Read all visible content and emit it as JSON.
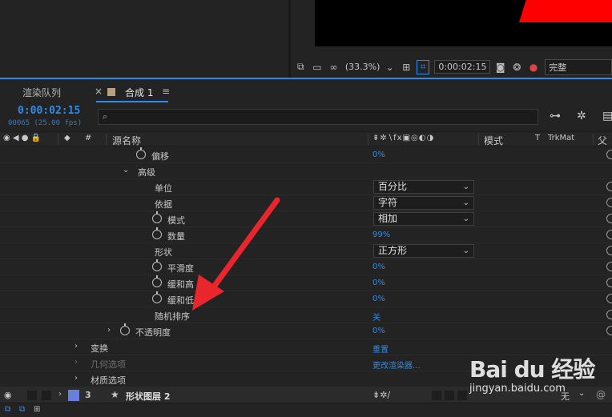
{
  "viewer_bar": {
    "zoom": "(33.3%)",
    "timecode": "0:00:02:15",
    "resolution": "完整"
  },
  "tabs": {
    "render_queue": "渲染队列",
    "comp": "合成 1"
  },
  "timeline": {
    "current_time": "0:00:02:15",
    "frames": "00065 (25.00 fps)",
    "search_placeholder": ""
  },
  "columns": {
    "hash": "#",
    "source_name": "源名称",
    "mode": "模式",
    "t": "T",
    "trkmat": "TrkMat",
    "parent": "父"
  },
  "rows": [
    {
      "label": "偏移",
      "value": "0%"
    },
    {
      "label": "高级"
    },
    {
      "label": "单位",
      "dropdown": "百分比"
    },
    {
      "label": "依据",
      "dropdown": "字符"
    },
    {
      "label": "模式",
      "dropdown": "相加"
    },
    {
      "label": "数量",
      "value": "99%"
    },
    {
      "label": "形状",
      "dropdown": "正方形"
    },
    {
      "label": "平滑度",
      "value": "0%"
    },
    {
      "label": "缓和高",
      "value": "0%"
    },
    {
      "label": "缓和低",
      "value": "0%"
    },
    {
      "label": "随机排序",
      "value": "关"
    },
    {
      "label": "不透明度",
      "value": "0%"
    },
    {
      "label": "变换",
      "value": "重置"
    },
    {
      "label": "几何选项",
      "value": "更改渲染器..."
    },
    {
      "label": "材质选项"
    }
  ],
  "layer": {
    "index": "3",
    "name": "形状图层 2",
    "mode_value": "无",
    "color": "#6a7fdc"
  },
  "watermark": {
    "logo": "Bai du 经验",
    "url": "jingyan.baidu.com"
  },
  "colors": {
    "accent": "#2d8ceb",
    "arrow": "#e8262c"
  }
}
